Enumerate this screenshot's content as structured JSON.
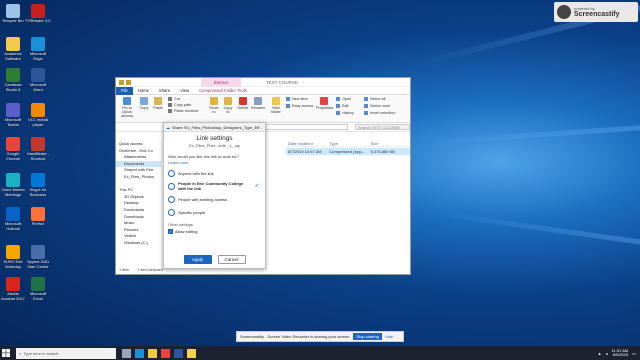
{
  "desktop": {
    "icons": [
      {
        "label": "Recycle Bin",
        "color": "#9ec3e8",
        "icon": "recycle-bin-icon"
      },
      {
        "label": "FSReader 3.0",
        "color": "#c81e1e",
        "icon": "fsreader-icon"
      },
      {
        "label": "Academic Software",
        "color": "#f2c94c",
        "icon": "folder-icon"
      },
      {
        "label": "Microsoft Edge",
        "color": "#1b8fd8",
        "icon": "edge-icon"
      },
      {
        "label": "Camtasia Studio 8",
        "color": "#2f7d32",
        "icon": "camtasia-icon"
      },
      {
        "label": "Microsoft Word",
        "color": "#2b579a",
        "icon": "word-icon"
      },
      {
        "label": "Microsoft Teams",
        "color": "#5b5fc7",
        "icon": "teams-icon"
      },
      {
        "label": "VLC media player",
        "color": "#f08a00",
        "icon": "vlc-icon"
      },
      {
        "label": "Google Chrome",
        "color": "#e8453c",
        "icon": "chrome-icon"
      },
      {
        "label": "HandBrake - Shortcut",
        "color": "#c0392b",
        "icon": "handbrake-icon"
      },
      {
        "label": "Cisco Webex Meetings",
        "color": "#1bb3c4",
        "icon": "webex-icon"
      },
      {
        "label": "Skype for Business",
        "color": "#0078d7",
        "icon": "skype-icon"
      },
      {
        "label": "Microsoft Outlook",
        "color": "#0a64c8",
        "icon": "outlook-icon"
      },
      {
        "label": "Firefox",
        "color": "#ff7139",
        "icon": "firefox-icon"
      },
      {
        "label": "SUNY Erie Workday",
        "color": "#f7a600",
        "icon": "workday-icon"
      },
      {
        "label": "Spybot-S&D Start Center",
        "color": "#4a6ea8",
        "icon": "spybot-icon"
      },
      {
        "label": "Adobe Acrobat 2017",
        "color": "#d8261e",
        "icon": "acrobat-icon"
      },
      {
        "label": "Microsoft Excel",
        "color": "#217346",
        "icon": "excel-icon"
      }
    ]
  },
  "badge": {
    "small": "powered by",
    "big": "Screencastify"
  },
  "explorer": {
    "context_tab": "Extract",
    "title": "TEST COURSE",
    "tabs": [
      "File",
      "Home",
      "Share",
      "View",
      "Compressed Folder Tools"
    ],
    "ribbon": {
      "pin": "Pin to Quick access",
      "copy": "Copy",
      "paste": "Paste",
      "cut": "Cut",
      "copy_path": "Copy path",
      "paste_shortcut": "Paste shortcut",
      "move_to": "Move to",
      "copy_to": "Copy to",
      "delete": "Delete",
      "rename": "Rename",
      "new_folder": "New folder",
      "new_item": "New item",
      "easy_access": "Easy access",
      "properties": "Properties",
      "open": "Open",
      "edit": "Edit",
      "history": "History",
      "select_all": "Select all",
      "select_none": "Select none",
      "invert_selection": "Invert selection"
    },
    "address": "TEST COURSE",
    "search_placeholder": "Search TEST COURSE",
    "nav": [
      {
        "label": "Quick access",
        "indent": false,
        "selected": false
      },
      {
        "label": "OneDrive - Erie Co",
        "indent": false,
        "selected": false
      },
      {
        "label": "Attachments",
        "indent": true,
        "selected": false
      },
      {
        "label": "Documents",
        "indent": true,
        "selected": true
      },
      {
        "label": "Shared with Erie",
        "indent": true,
        "selected": false
      },
      {
        "label": "Ex_Files_Photos",
        "indent": true,
        "selected": false
      },
      {
        "label": "",
        "indent": false,
        "selected": false
      },
      {
        "label": "This PC",
        "indent": false,
        "selected": false
      },
      {
        "label": "3D Objects",
        "indent": true,
        "selected": false
      },
      {
        "label": "Desktop",
        "indent": true,
        "selected": false
      },
      {
        "label": "Documents",
        "indent": true,
        "selected": false
      },
      {
        "label": "Downloads",
        "indent": true,
        "selected": false
      },
      {
        "label": "Music",
        "indent": true,
        "selected": false
      },
      {
        "label": "Pictures",
        "indent": true,
        "selected": false
      },
      {
        "label": "Videos",
        "indent": true,
        "selected": false
      },
      {
        "label": "Windows (C:)",
        "indent": true,
        "selected": false
      }
    ],
    "columns": [
      "Date modified",
      "Type",
      "Size"
    ],
    "file": {
      "date": "8/7/2019 10:57 AM",
      "type": "Compressed (zipp...",
      "size": "5,476,880 KB"
    },
    "status_items": "1 item",
    "status_selected": "1 item selected"
  },
  "share_dialog": {
    "header": "Share 'Ex_Files_Photoshop_Designers_Type_Eff...",
    "title": "Link settings",
    "filename": "Ex_Files_Phot...dule _1_.zip",
    "question": "Who would you like this link to work for?",
    "learn_more": "Learn more",
    "options": [
      {
        "label": "Anyone with the link",
        "selected": false
      },
      {
        "label": "People in Erie Community College with the link",
        "selected": true
      },
      {
        "label": "People with existing access",
        "selected": false
      },
      {
        "label": "Specific people",
        "selected": false
      }
    ],
    "other_settings": "Other settings",
    "allow_editing": "Allow editing",
    "apply": "Apply",
    "cancel": "Cancel"
  },
  "screencastify_bar": {
    "message": "Screencastify - Screen Video Recorder is sharing your screen.",
    "stop": "Stop sharing",
    "hide": "Hide"
  },
  "taskbar": {
    "search_placeholder": "Type here to search",
    "time": "11:01 AM",
    "date": "8/9/2019"
  }
}
